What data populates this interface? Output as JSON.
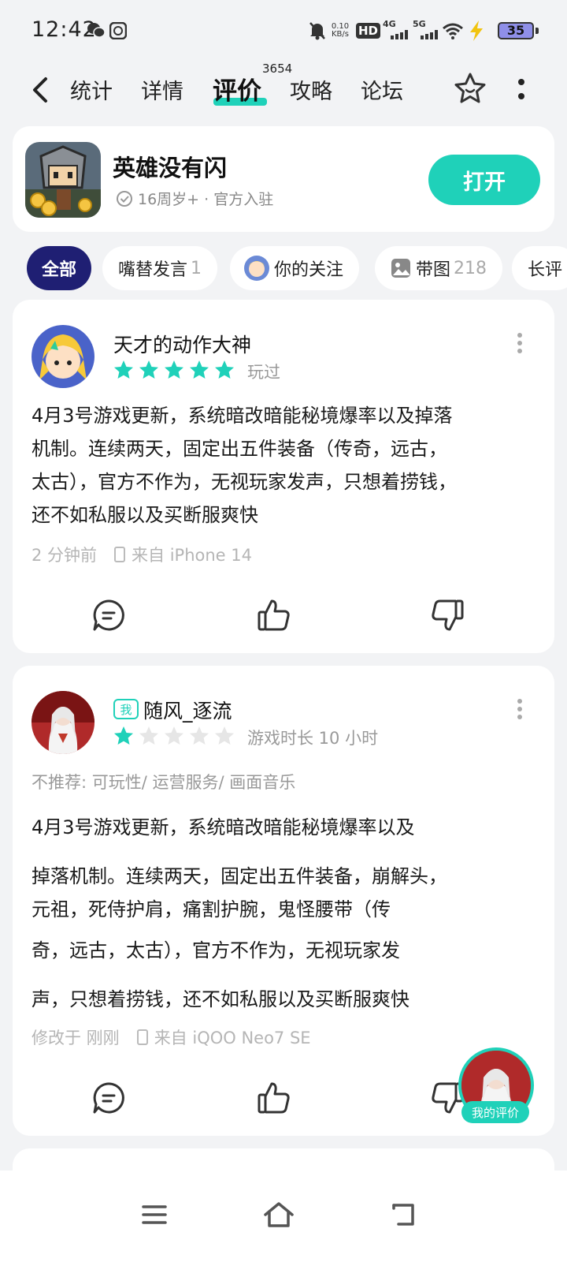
{
  "status_bar": {
    "time": "12:42",
    "net_speed_top": "0.10",
    "net_speed_bottom": "KB/s",
    "hd_label": "HD",
    "signal1": "4G",
    "signal2": "5G",
    "battery": "35",
    "icons": [
      "wechat-icon",
      "app-icon",
      "mute-icon",
      "hd-icon",
      "signal-4g-icon",
      "signal-5g-icon",
      "wifi-icon",
      "charging-icon",
      "battery-icon"
    ]
  },
  "nav": {
    "tabs": [
      {
        "label": "统计"
      },
      {
        "label": "详情"
      },
      {
        "label": "评价"
      },
      {
        "label": "攻略"
      },
      {
        "label": "论坛"
      }
    ],
    "review_count": "3654",
    "accent": "#1fd1b9"
  },
  "game": {
    "name": "英雄没有闪",
    "meta": "16周岁+ · 官方入驻",
    "open_label": "打开"
  },
  "filters": [
    {
      "label": "全部",
      "count": ""
    },
    {
      "label": "嘴替发言",
      "count": "1"
    },
    {
      "label": "你的关注",
      "count": ""
    },
    {
      "label": "带图",
      "count": "218"
    },
    {
      "label": "长评",
      "count": ""
    }
  ],
  "reviews": [
    {
      "user": "天才的动作大神",
      "rating": 5,
      "rating_note": "玩过",
      "lines": [
        "4月3号游戏更新，系统暗改暗能秘境爆率以及掉落",
        "机制。连续两天，固定出五件装备（传奇，远古，",
        "太古），官方不作为，无视玩家发声，只想着捞钱，",
        "还不如私服以及买断服爽快"
      ],
      "time": "2 分钟前",
      "device": "来自 iPhone 14"
    },
    {
      "me_badge": "我",
      "user": "随风_逐流",
      "rating": 1,
      "rating_note": "游戏时长 10 小时",
      "tags": "不推荐: 可玩性/ 运营服务/ 画面音乐",
      "lines": [
        "4月3号游戏更新，系统暗改暗能秘境爆率以及",
        "掉落机制。连续两天，固定出五件装备，崩解头，",
        "元祖，死侍护肩，痛割护腕，鬼怪腰带（传",
        "奇，远古，太古），官方不作为，无视玩家发",
        "声，只想着捞钱，还不如私服以及买断服爽快"
      ],
      "time": "修改于 刚刚",
      "device": "来自  iQOO Neo7 SE"
    }
  ],
  "fab": {
    "label": "我的评价"
  }
}
